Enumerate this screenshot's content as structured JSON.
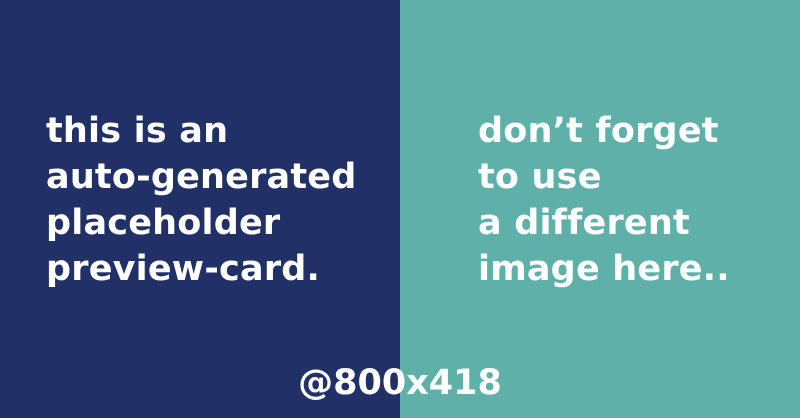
{
  "card": {
    "left_panel": {
      "background": "#213066",
      "lines": [
        "this is an",
        "auto-generated",
        "placeholder",
        "preview-card."
      ]
    },
    "right_panel": {
      "background": "#5eb0a9",
      "lines": [
        "don’t forget",
        "to use",
        "a different",
        "image here.."
      ]
    },
    "size_label": "@800x418",
    "text_color": "#ffffff"
  }
}
